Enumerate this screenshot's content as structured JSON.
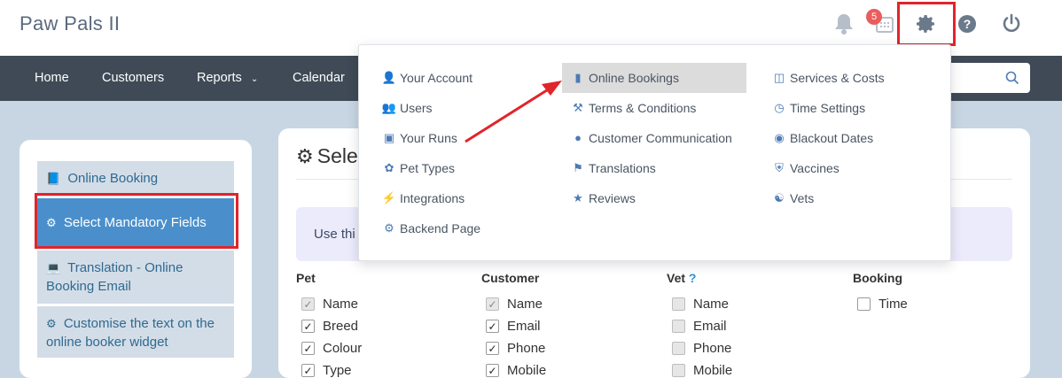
{
  "app": {
    "title": "Paw Pals II"
  },
  "header": {
    "notification_count": "5"
  },
  "nav": {
    "items": [
      "Home",
      "Customers",
      "Reports",
      "Calendar"
    ]
  },
  "sidebar": {
    "items": [
      {
        "label": "Online Booking"
      },
      {
        "label": "Select Mandatory Fields"
      },
      {
        "label": "Translation - Online Booking Email"
      },
      {
        "label": "Customise the text on the online booker widget"
      }
    ]
  },
  "main": {
    "title": "Sele",
    "info_text": "Use thi",
    "columns": [
      {
        "heading": "Pet",
        "rows": [
          {
            "label": "Name",
            "state": "checked-disabled"
          },
          {
            "label": "Breed",
            "state": "checked"
          },
          {
            "label": "Colour",
            "state": "checked"
          },
          {
            "label": "Type",
            "state": "checked"
          }
        ]
      },
      {
        "heading": "Customer",
        "rows": [
          {
            "label": "Name",
            "state": "checked-disabled"
          },
          {
            "label": "Email",
            "state": "checked"
          },
          {
            "label": "Phone",
            "state": "checked"
          },
          {
            "label": "Mobile",
            "state": "checked"
          }
        ]
      },
      {
        "heading": "Vet",
        "help": "?",
        "rows": [
          {
            "label": "Name",
            "state": "unchecked-grey"
          },
          {
            "label": "Email",
            "state": "unchecked-grey"
          },
          {
            "label": "Phone",
            "state": "unchecked-grey"
          },
          {
            "label": "Mobile",
            "state": "unchecked-grey"
          }
        ]
      },
      {
        "heading": "Booking",
        "rows": [
          {
            "label": "Time",
            "state": "unchecked"
          }
        ]
      }
    ]
  },
  "settings_menu": {
    "col1": [
      "Your Account",
      "Users",
      "Your Runs",
      "Pet Types",
      "Integrations",
      "Backend Page"
    ],
    "col2": [
      "Online Bookings",
      "Terms & Conditions",
      "Customer Communication",
      "Translations",
      "Reviews"
    ],
    "col3": [
      "Services & Costs",
      "Time Settings",
      "Blackout Dates",
      "Vaccines",
      "Vets"
    ],
    "highlighted": "Online Bookings"
  },
  "colors": {
    "nav_bg": "#3f4a56",
    "accent": "#4a8fcc",
    "annotation": "#e0252b"
  }
}
